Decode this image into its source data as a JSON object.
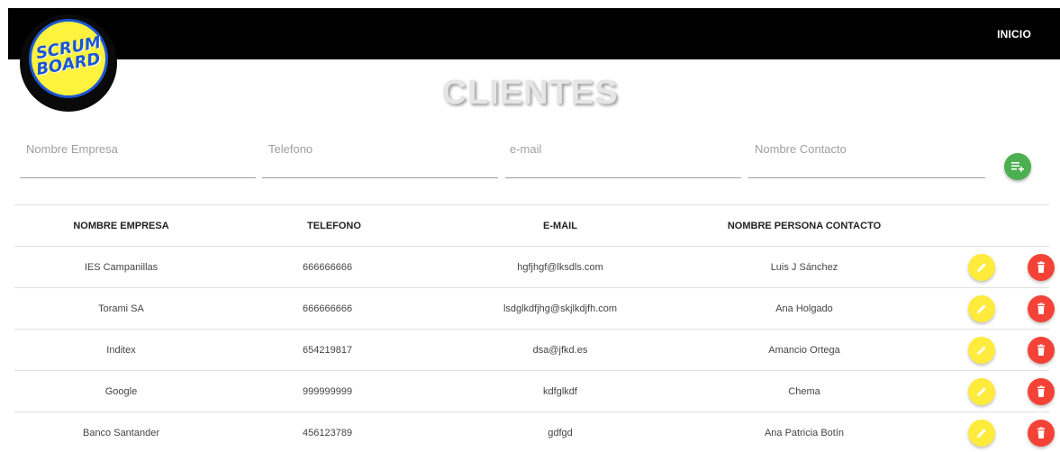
{
  "header": {
    "logo_line1": "SCRUM",
    "logo_line2": "BOARD",
    "nav_inicio": "INICIO"
  },
  "page": {
    "title": "CLIENTES"
  },
  "form": {
    "empresa_placeholder": "Nombre Empresa",
    "telefono_placeholder": "Telefono",
    "email_placeholder": "e-mail",
    "contacto_placeholder": "Nombre Contacto",
    "add_icon": "playlist-add-icon"
  },
  "table": {
    "headers": [
      "NOMBRE EMPRESA",
      "TELEFONO",
      "E-MAIL",
      "NOMBRE PERSONA CONTACTO"
    ],
    "rows": [
      {
        "empresa": "IES Campanillas",
        "telefono": "666666666",
        "email": "hgfjhgf@lksdls.com",
        "contacto": "Luis J Sánchez"
      },
      {
        "empresa": "Torami SA",
        "telefono": "666666666",
        "email": "lsdglkdfjhg@skjlkdjfh.com",
        "contacto": "Ana Holgado"
      },
      {
        "empresa": "Inditex",
        "telefono": "654219817",
        "email": "dsa@jfkd.es",
        "contacto": "Amancio Ortega"
      },
      {
        "empresa": "Google",
        "telefono": "999999999",
        "email": "kdfglkdf",
        "contacto": "Chema"
      },
      {
        "empresa": "Banco Santander",
        "telefono": "456123789",
        "email": "gdfgd",
        "contacto": "Ana Patricia Botín"
      }
    ],
    "edit_icon": "pencil-icon",
    "delete_icon": "trash-icon"
  },
  "colors": {
    "topbar": "#000000",
    "add_button": "#4caf50",
    "edit_button": "#ffeb3b",
    "delete_button": "#f44336",
    "logo_yellow": "#fdf23e",
    "logo_blue": "#1b57d1"
  }
}
